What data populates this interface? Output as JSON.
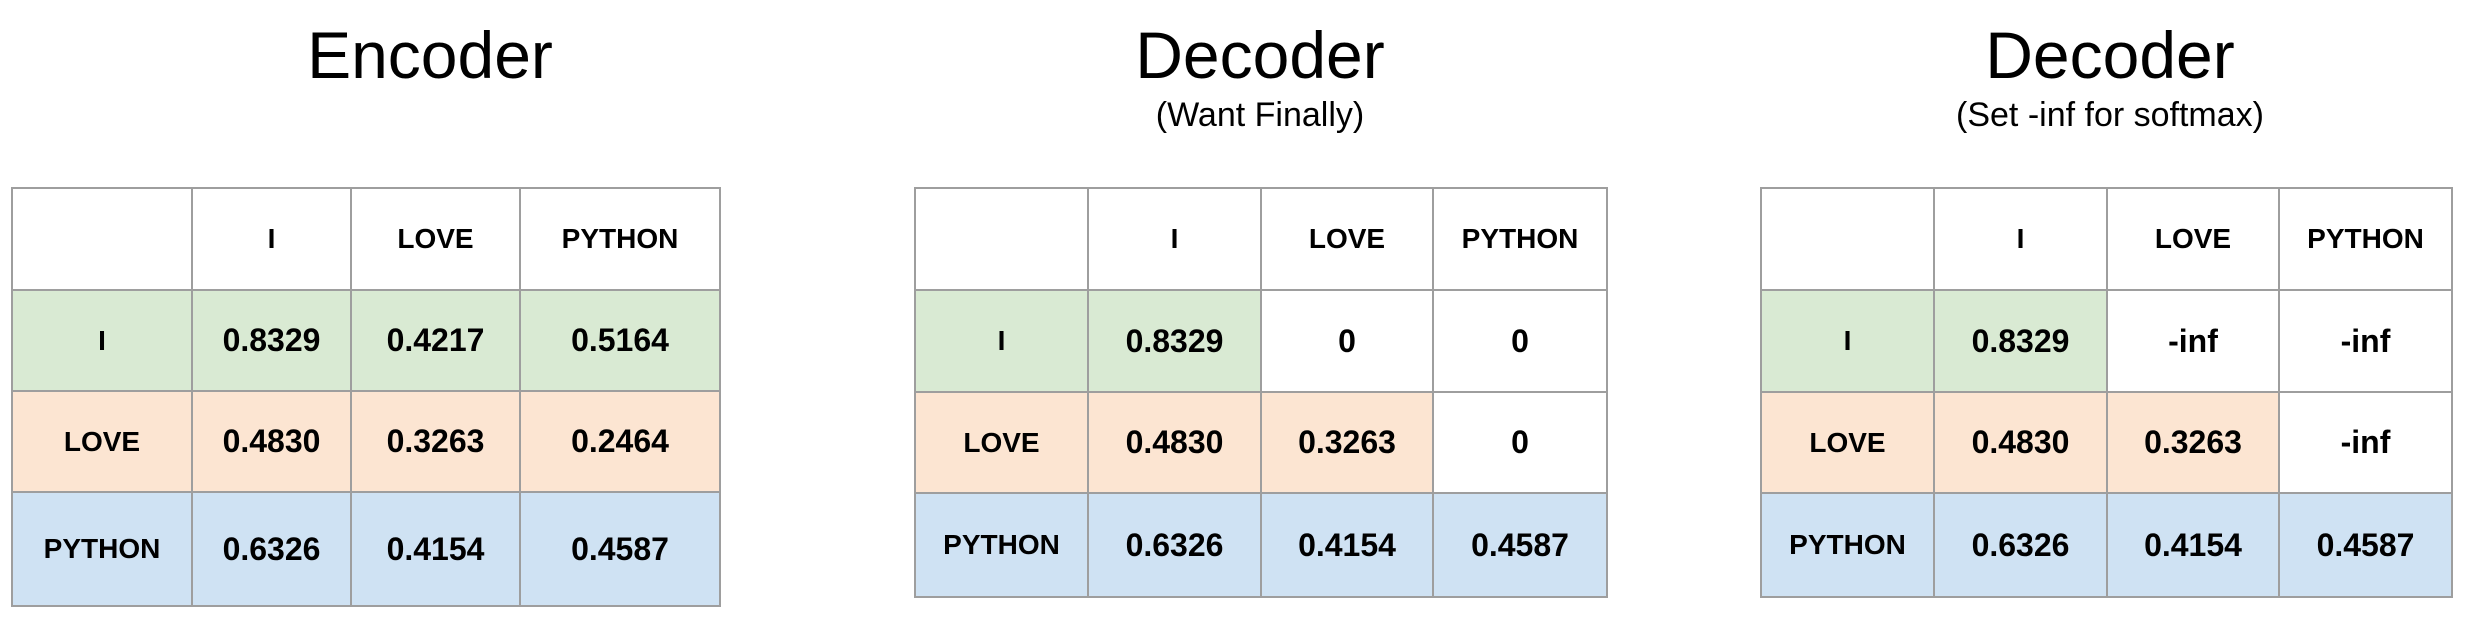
{
  "colors": {
    "row_i": "#d9ead3",
    "row_love": "#fce5d2",
    "row_python": "#cfe2f3",
    "border": "#9e9e9e",
    "empty": "#ffffff"
  },
  "panels": [
    {
      "title": "Encoder",
      "subtitle": "",
      "columns": [
        "",
        "I",
        "LOVE",
        "PYTHON"
      ],
      "rows": [
        {
          "label": "I",
          "values": [
            "0.8329",
            "0.4217",
            "0.5164"
          ]
        },
        {
          "label": "LOVE",
          "values": [
            "0.4830",
            "0.3263",
            "0.2464"
          ]
        },
        {
          "label": "PYTHON",
          "values": [
            "0.6326",
            "0.4154",
            "0.4587"
          ]
        }
      ]
    },
    {
      "title": "Decoder",
      "subtitle": "(Want Finally)",
      "columns": [
        "",
        "I",
        "LOVE",
        "PYTHON"
      ],
      "rows": [
        {
          "label": "I",
          "values": [
            "0.8329",
            "0",
            "0"
          ]
        },
        {
          "label": "LOVE",
          "values": [
            "0.4830",
            "0.3263",
            "0"
          ]
        },
        {
          "label": "PYTHON",
          "values": [
            "0.6326",
            "0.4154",
            "0.4587"
          ]
        }
      ]
    },
    {
      "title": "Decoder",
      "subtitle": "(Set -inf for softmax)",
      "columns": [
        "",
        "I",
        "LOVE",
        "PYTHON"
      ],
      "rows": [
        {
          "label": "I",
          "values": [
            "0.8329",
            "-inf",
            "-inf"
          ]
        },
        {
          "label": "LOVE",
          "values": [
            "0.4830",
            "0.3263",
            "-inf"
          ]
        },
        {
          "label": "PYTHON",
          "values": [
            "0.6326",
            "0.4154",
            "0.4587"
          ]
        }
      ]
    }
  ]
}
